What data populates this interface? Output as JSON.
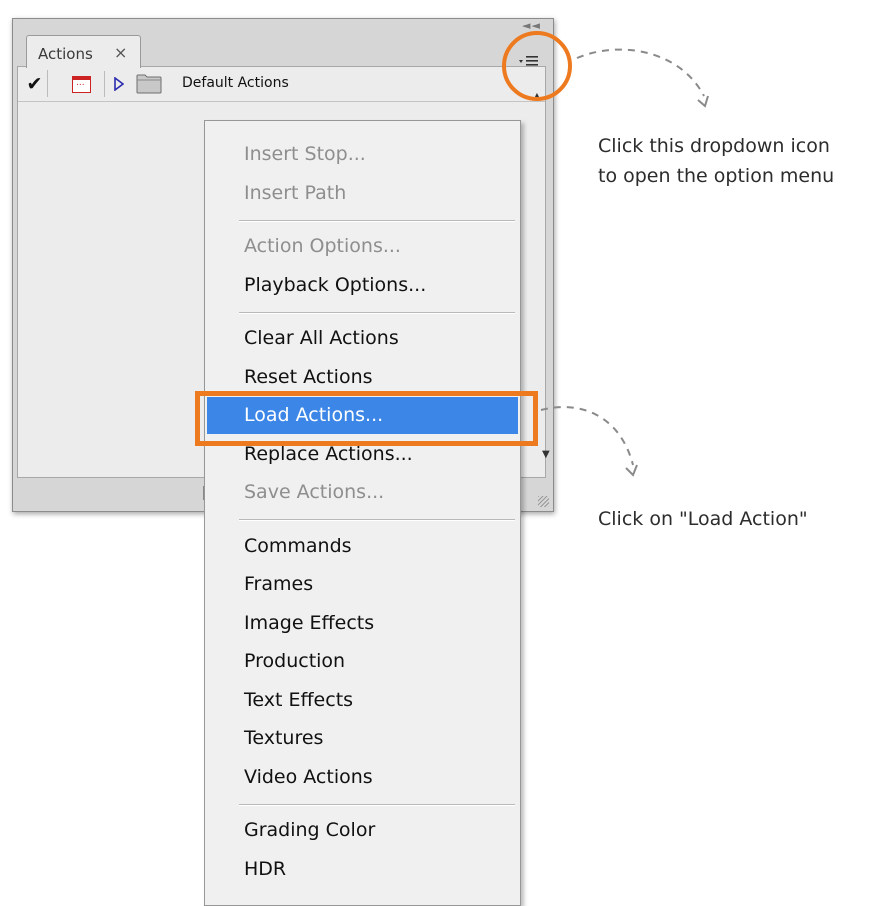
{
  "panel": {
    "tab_label": "Actions",
    "tab_close": "×",
    "collapse_glyph": "◄◄",
    "action_set": {
      "checked": true,
      "label": "Default Actions"
    }
  },
  "menu": {
    "groups": [
      [
        {
          "label": "Insert Stop...",
          "enabled": false
        },
        {
          "label": "Insert Path",
          "enabled": false
        }
      ],
      [
        {
          "label": "Action Options...",
          "enabled": false
        },
        {
          "label": "Playback Options...",
          "enabled": true
        }
      ],
      [
        {
          "label": "Clear All Actions",
          "enabled": true
        },
        {
          "label": "Reset Actions",
          "enabled": true
        },
        {
          "label": "Load Actions...",
          "enabled": true,
          "highlighted": true
        },
        {
          "label": "Replace Actions...",
          "enabled": true
        },
        {
          "label": "Save Actions...",
          "enabled": false
        }
      ],
      [
        {
          "label": "Commands",
          "enabled": true
        },
        {
          "label": "Frames",
          "enabled": true
        },
        {
          "label": "Image Effects",
          "enabled": true
        },
        {
          "label": "Production",
          "enabled": true
        },
        {
          "label": "Text Effects",
          "enabled": true
        },
        {
          "label": "Textures",
          "enabled": true
        },
        {
          "label": "Video Actions",
          "enabled": true
        }
      ],
      [
        {
          "label": "Grading Color",
          "enabled": true
        },
        {
          "label": "HDR",
          "enabled": true
        }
      ]
    ]
  },
  "annotations": {
    "note_dropdown_line1": "Click this dropdown icon",
    "note_dropdown_line2": "to open the option menu",
    "note_load": "Click on \"Load Action\""
  },
  "colors": {
    "accent_orange": "#ee7a1f",
    "menu_highlight": "#3b86e6"
  }
}
